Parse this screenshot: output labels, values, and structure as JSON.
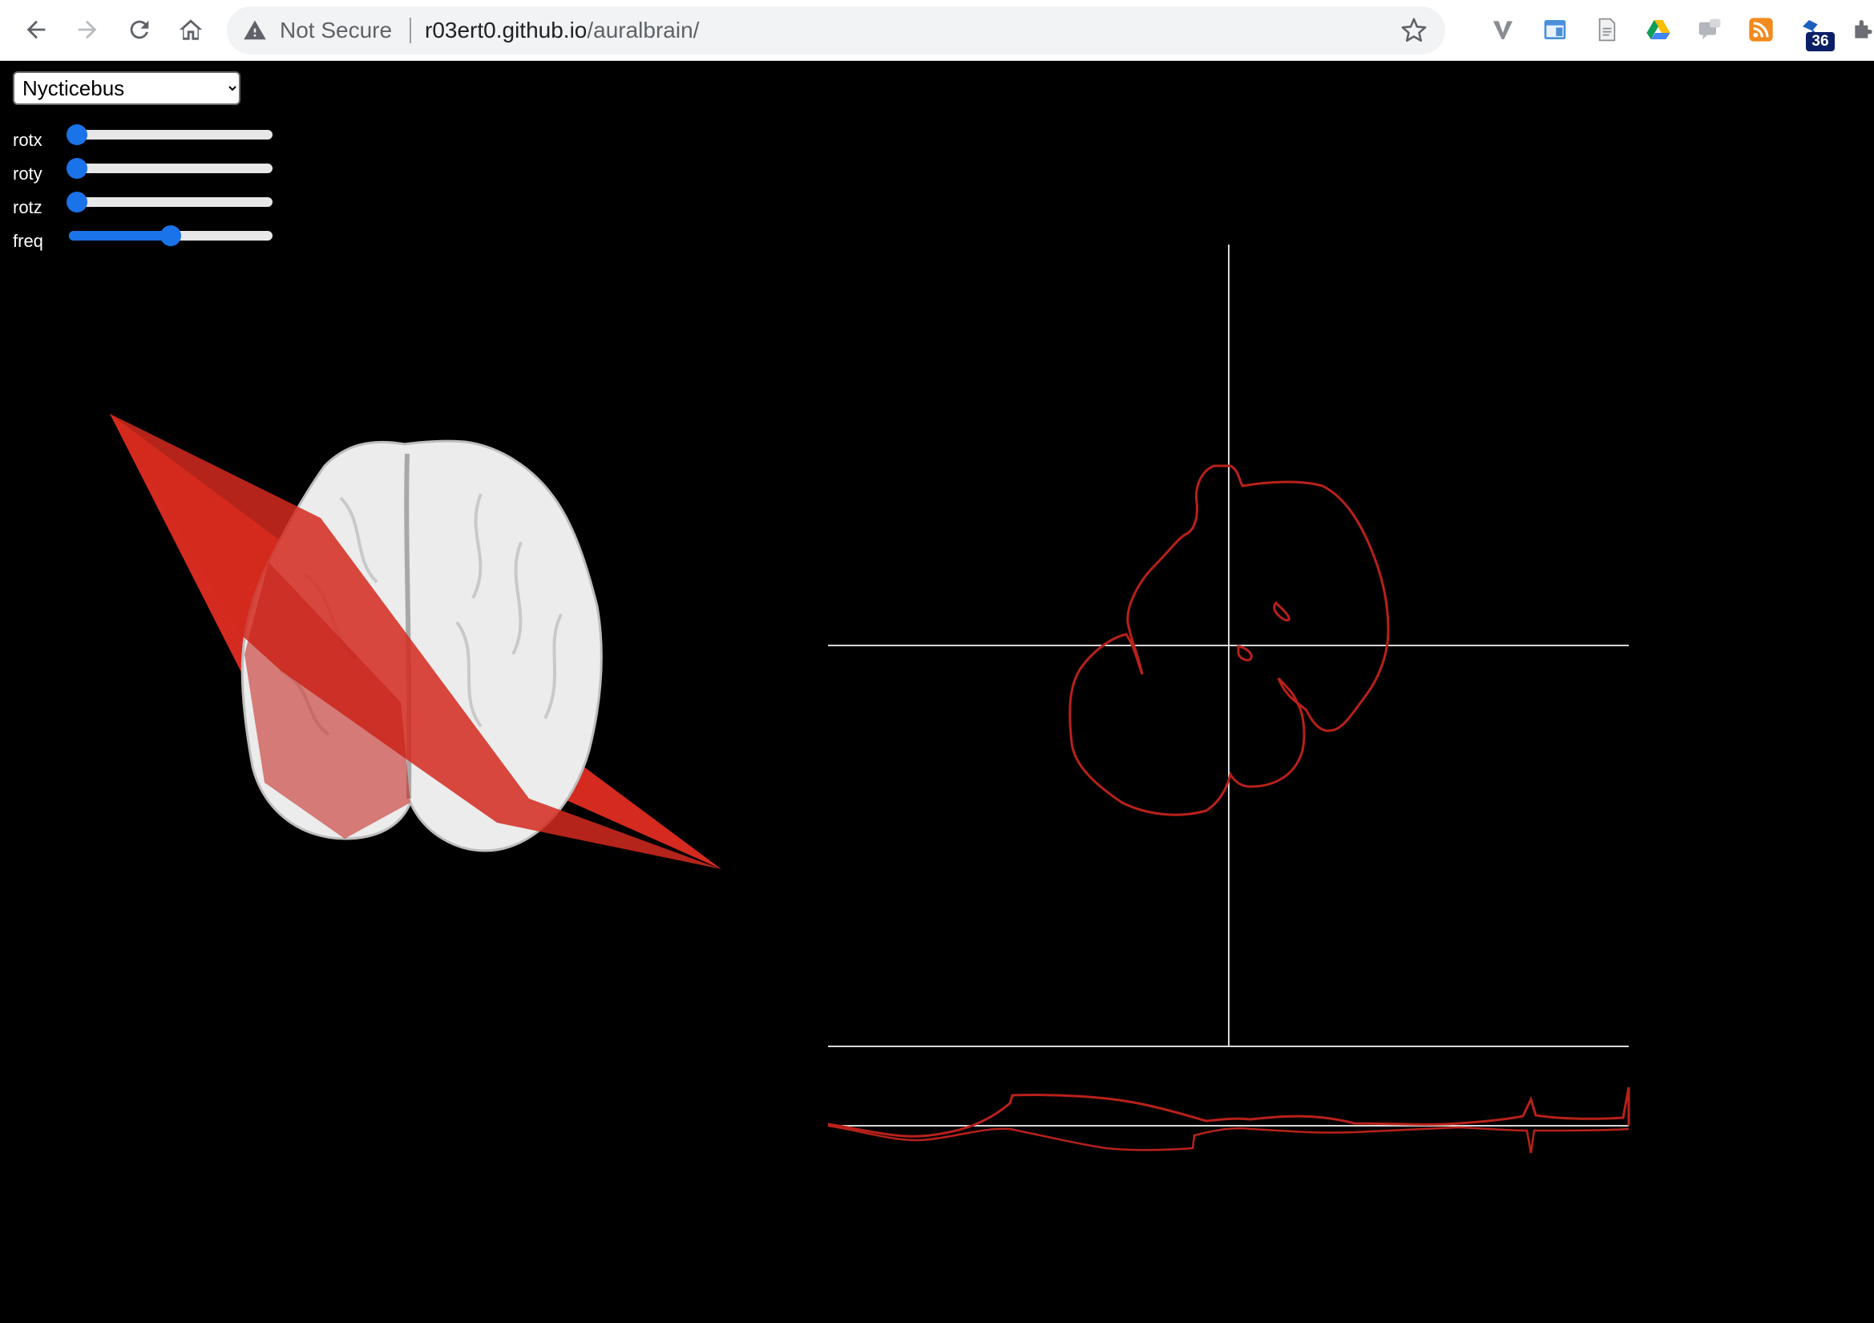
{
  "browser": {
    "security_label": "Not Secure",
    "url_host": "r03ert0.github.io",
    "url_path": "/auralbrain/",
    "extension_badge": "36"
  },
  "controls": {
    "species_selected": "Nycticebus",
    "sliders": [
      {
        "label": "rotx",
        "value": 0.04
      },
      {
        "label": "roty",
        "value": 0.04
      },
      {
        "label": "rotz",
        "value": 0.04
      },
      {
        "label": "freq",
        "value": 0.5
      }
    ]
  },
  "colors": {
    "background": "#000000",
    "cut_plane": "#d42a1f",
    "section_outline": "#b8211a",
    "axes": "#d9d9d9",
    "brain_surface": "#ececec",
    "slider_accent": "#1a73e8"
  },
  "icons": [
    "back-icon",
    "forward-icon",
    "reload-icon",
    "home-icon",
    "warning-icon",
    "bookmark-star-icon",
    "vivaldi-icon",
    "window-icon",
    "document-icon",
    "drive-icon",
    "chat-icon",
    "rss-icon",
    "extension-icon",
    "puzzle-icon"
  ]
}
